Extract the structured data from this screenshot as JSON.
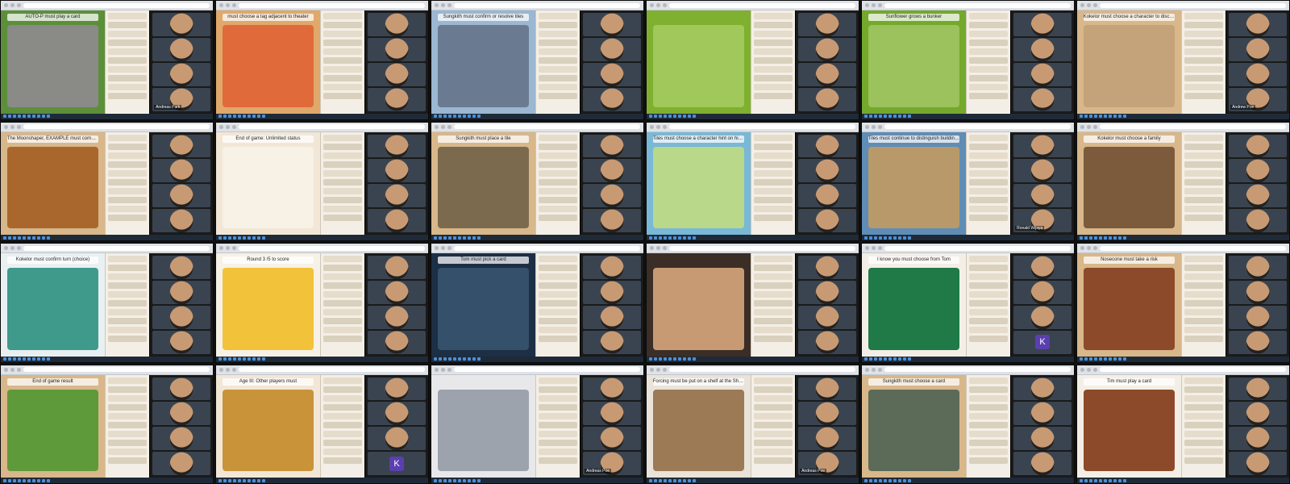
{
  "tiles": [
    {
      "row": 1,
      "col": 1,
      "status": "AUTO-P must play a card",
      "bg": "#5c8f3a",
      "art": "#8a8a86"
    },
    {
      "row": 1,
      "col": 2,
      "status": "must choose a tag adjacent to theater",
      "bg": "#e0a86a",
      "art": "#e06a3a"
    },
    {
      "row": 1,
      "col": 3,
      "status": "Sungkith must confirm or resolve tiles",
      "bg": "#9bb7d1",
      "art": "#6a7b91"
    },
    {
      "row": 1,
      "col": 4,
      "status": "",
      "bg": "#7fb02f",
      "art": "#a0c85a"
    },
    {
      "row": 1,
      "col": 5,
      "status": "Sunflower grows a bunker",
      "bg": "#74a92c",
      "art": "#9bc25d"
    },
    {
      "row": 1,
      "col": 6,
      "status": "Kokelor must choose a character to discard from the deck",
      "bg": "#d8b78a",
      "art": "#c4a37a"
    },
    {
      "row": 2,
      "col": 1,
      "status": "The Moonshaper, EXAMPLE must command a card from the discard pile for free",
      "bg": "#d8b78a",
      "art": "#a9672e"
    },
    {
      "row": 2,
      "col": 2,
      "status": "End of game: Unlimited status",
      "bg": "#f2e7d6",
      "art": "#f7f1e6"
    },
    {
      "row": 2,
      "col": 3,
      "status": "Sungkith must place a tile",
      "bg": "#d8b78a",
      "art": "#7c6a4e"
    },
    {
      "row": 2,
      "col": 4,
      "status": "Tiles must choose a character hint on his players path",
      "bg": "#79b8d6",
      "art": "#b9d88a"
    },
    {
      "row": 2,
      "col": 5,
      "status": "Tiles must continue to distinguish building enemy path",
      "bg": "#5f8db6",
      "art": "#b89a6a"
    },
    {
      "row": 2,
      "col": 6,
      "status": "Kokelor must choose a family",
      "bg": "#d8b78a",
      "art": "#7c5a3c"
    },
    {
      "row": 3,
      "col": 1,
      "status": "Kokelor must confirm turn (choice)",
      "bg": "#e9f0f2",
      "art": "#3f9a8c"
    },
    {
      "row": 3,
      "col": 2,
      "status": "Round 3 /5 to score",
      "bg": "#f7f1e6",
      "art": "#f2c23a"
    },
    {
      "row": 3,
      "col": 3,
      "status": "Tom must pick a card",
      "bg": "#1c2f45",
      "art": "#35506a"
    },
    {
      "row": 3,
      "col": 4,
      "status": "",
      "bg": "#3a2e26",
      "art": "#c89a73"
    },
    {
      "row": 3,
      "col": 5,
      "status": "I know you must choose from Tom",
      "bg": "#f4efe6",
      "art": "#1f7a48"
    },
    {
      "row": 3,
      "col": 6,
      "status": "Nosecone must take a risk",
      "bg": "#d8b78a",
      "art": "#8c4a2a"
    },
    {
      "row": 4,
      "col": 1,
      "status": "End of game result",
      "bg": "#d8b78a",
      "art": "#5e9a3a"
    },
    {
      "row": 4,
      "col": 2,
      "status": "Age III: Other players must",
      "bg": "#f2e7d6",
      "art": "#c9933a"
    },
    {
      "row": 4,
      "col": 3,
      "status": "",
      "bg": "#e8e8ea",
      "art": "#9da3ad"
    },
    {
      "row": 4,
      "col": 4,
      "status": "Forcing must be put on a shelf at the Shining Hares Tavern",
      "bg": "#e9e3d9",
      "art": "#9c7a56"
    },
    {
      "row": 4,
      "col": 5,
      "status": "Sungkith must choose a card",
      "bg": "#d8b78a",
      "art": "#5c6a58"
    },
    {
      "row": 4,
      "col": 6,
      "status": "Tim must play a card",
      "bg": "#f4efe6",
      "art": "#8c4a2a"
    }
  ],
  "video_labels": {
    "1_1": "Andreas Park",
    "1_6": "Andrew Poe",
    "2_5": "Ronald Wijaya",
    "4_3": "Andreas Poe",
    "4_4": "Andreas Poe"
  },
  "k_avatar_tiles": [
    "3_5",
    "4_2"
  ],
  "k_avatar_letter": "K"
}
